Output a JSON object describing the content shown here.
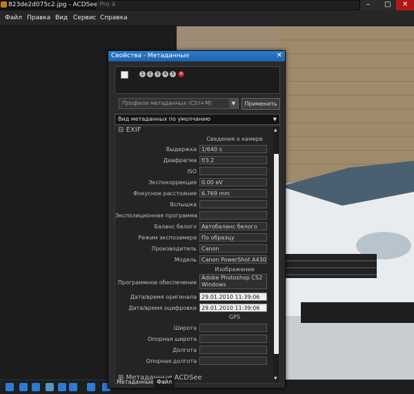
{
  "window": {
    "title": "823de2d075c2.jpg - ACDSee Pro 4"
  },
  "menu": [
    "Файл",
    "Правка",
    "Вид",
    "Сервис",
    "Справка"
  ],
  "panel": {
    "title": "Свойства - Метаданные",
    "badges": [
      "1",
      "2",
      "3",
      "4",
      "5",
      "✕"
    ],
    "profile_placeholder": "Профили метаданных (Ctrl+M)",
    "apply_label": "Применить",
    "view_label": "Вид метаданных по умолчанию",
    "exif_header": "EXIF",
    "section_camera": "Сведения о камере",
    "section_image": "Изображение",
    "section_gps": "GPS",
    "acdsee_header": "Метаданные ACDSee",
    "fields": [
      {
        "label": "Выдержка",
        "value": "1/640 s"
      },
      {
        "label": "Диафрагма",
        "value": "f/3.2"
      },
      {
        "label": "ISO",
        "value": ""
      },
      {
        "label": "Экспокоррекция",
        "value": "0.00 eV"
      },
      {
        "label": "Фокусное расстояние",
        "value": "6.769 mm"
      },
      {
        "label": "Вспышка",
        "value": ""
      },
      {
        "label": "Экспозиционная программа",
        "value": ""
      },
      {
        "label": "Баланс белого",
        "value": "Автобаланс белого"
      },
      {
        "label": "Режим экспозамера",
        "value": "По образцу"
      },
      {
        "label": "Производитель",
        "value": "Canon"
      },
      {
        "label": "Модель",
        "value": "Canon PowerShot A430"
      }
    ],
    "image_fields": [
      {
        "label": "Программное обеспечение",
        "value": "Adobe Photoshop CS2 Windows"
      },
      {
        "label": "Дата/время оригинала",
        "value": "29.01.2010 11:39:06"
      },
      {
        "label": "Дата/время оцифровки",
        "value": "29.01.2010 11:39:06"
      }
    ],
    "gps_fields": [
      {
        "label": "Широта",
        "value": ""
      },
      {
        "label": "Опорная широта",
        "value": ""
      },
      {
        "label": "Долгота",
        "value": ""
      },
      {
        "label": "Опорная долгота",
        "value": ""
      }
    ],
    "tabs": [
      "Метаданные",
      "Файл"
    ]
  },
  "colors": {
    "accent": "#2a7fd1",
    "close": "#c02020"
  }
}
